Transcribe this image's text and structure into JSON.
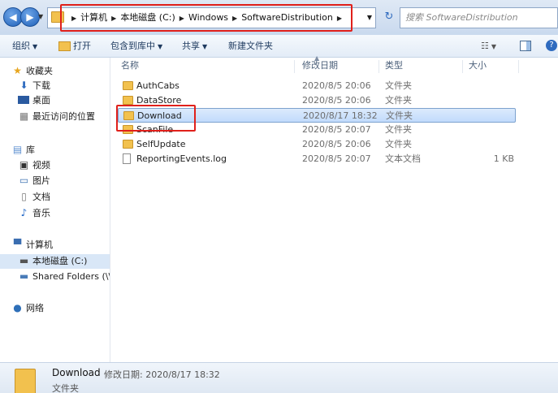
{
  "address_bar": {
    "crumbs": [
      "计算机",
      "本地磁盘 (C:)",
      "Windows",
      "SoftwareDistribution"
    ],
    "search_placeholder": "搜索 SoftwareDistribution"
  },
  "toolbar": {
    "organize": "组织",
    "open": "打开",
    "include_library": "包含到库中",
    "share": "共享",
    "new_folder": "新建文件夹"
  },
  "sidebar": {
    "favorites": "收藏夹",
    "downloads": "下载",
    "desktop": "桌面",
    "recent": "最近访问的位置",
    "library": "库",
    "videos": "视频",
    "pictures": "图片",
    "documents": "文档",
    "music": "音乐",
    "computer": "计算机",
    "local_disk": "本地磁盘 (C:)",
    "shared_folders": "Shared Folders (\\\\",
    "network": "网络"
  },
  "columns": {
    "name": "名称",
    "date": "修改日期",
    "type": "类型",
    "size": "大小"
  },
  "files": [
    {
      "name": "AuthCabs",
      "date": "2020/8/5 20:06",
      "type": "文件夹",
      "size": ""
    },
    {
      "name": "DataStore",
      "date": "2020/8/5 20:06",
      "type": "文件夹",
      "size": ""
    },
    {
      "name": "Download",
      "date": "2020/8/17 18:32",
      "type": "文件夹",
      "size": ""
    },
    {
      "name": "ScanFile",
      "date": "2020/8/5 20:07",
      "type": "文件夹",
      "size": ""
    },
    {
      "name": "SelfUpdate",
      "date": "2020/8/5 20:06",
      "type": "文件夹",
      "size": ""
    },
    {
      "name": "ReportingEvents.log",
      "date": "2020/8/5 20:07",
      "type": "文本文档",
      "size": "1 KB"
    }
  ],
  "details": {
    "name": "Download",
    "meta": "修改日期: 2020/8/17 18:32",
    "type": "文件夹"
  }
}
